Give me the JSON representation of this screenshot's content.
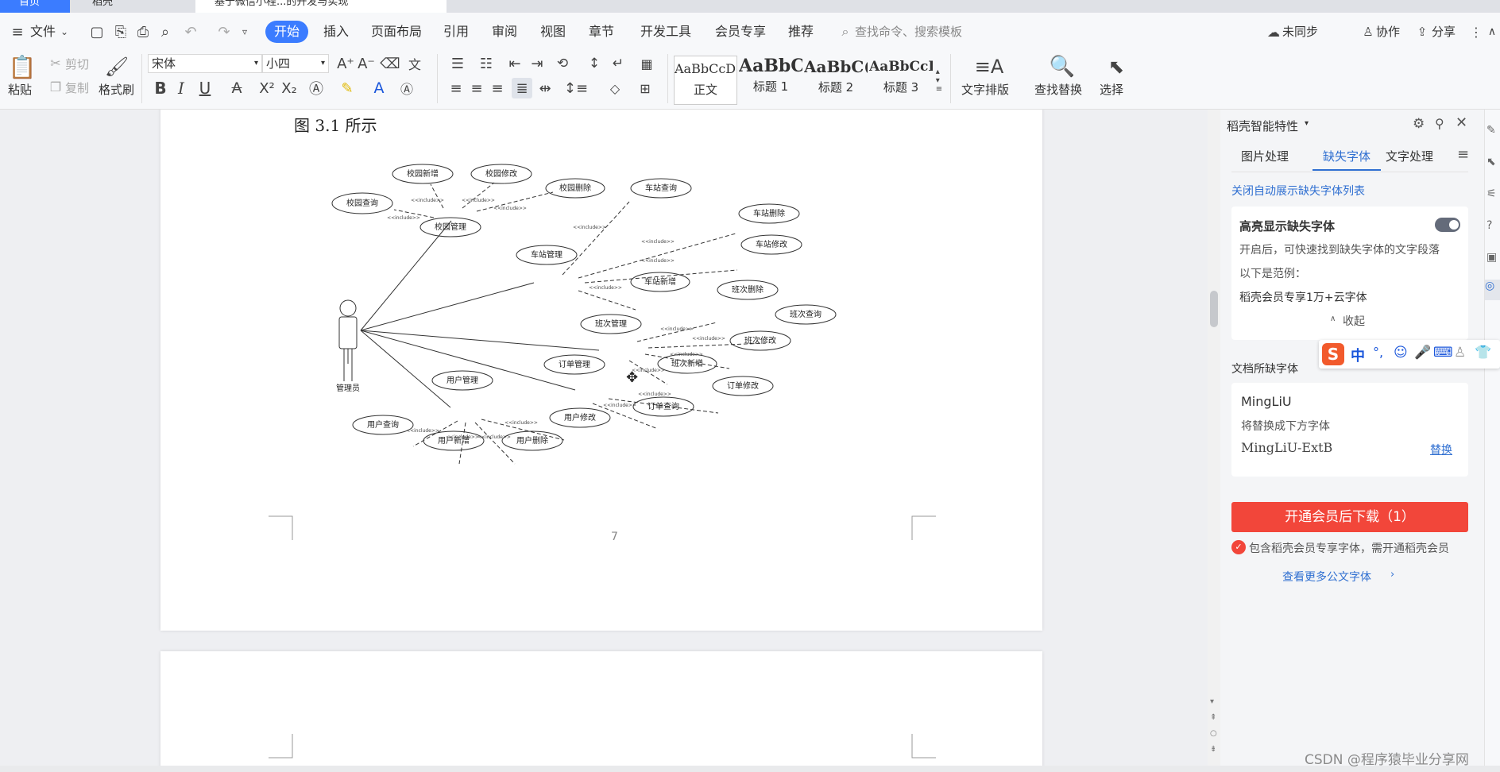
{
  "tabs": [
    {
      "label": "首页"
    },
    {
      "label": "稻壳"
    },
    {
      "label": "基于微信小程...的开发与实现"
    }
  ],
  "menu": {
    "file": "文件",
    "items": [
      "开始",
      "插入",
      "页面布局",
      "引用",
      "审阅",
      "视图",
      "章节",
      "开发工具",
      "会员专享",
      "推荐"
    ],
    "search_placeholder": "查找命令、搜索模板",
    "sync": "未同步",
    "collab": "协作",
    "share": "分享"
  },
  "ribbon": {
    "paste": "粘贴",
    "cut": "剪切",
    "copy": "复制",
    "format_painter": "格式刷",
    "font": "宋体",
    "size": "小四",
    "styles": [
      {
        "preview": "AaBbCcDd",
        "name": "正文"
      },
      {
        "preview": "AaBbC",
        "name": "标题 1"
      },
      {
        "preview": "AaBbC(",
        "name": "标题 2"
      },
      {
        "preview": "AaBbCcI",
        "name": "标题 3"
      }
    ],
    "text_layout": "文字排版",
    "find_replace": "查找替换",
    "select": "选择"
  },
  "document": {
    "caption": "图 3.1 所示",
    "page_number": "7"
  },
  "diagram": {
    "actor": "管理员",
    "include": "<<include>>",
    "nodes": {
      "campus_mgmt": "校园管理",
      "campus_add": "校园新增",
      "campus_edit": "校园修改",
      "campus_del": "校园删除",
      "campus_query": "校园查询",
      "station_mgmt": "车站管理",
      "station_query": "车站查询",
      "station_del": "车站删除",
      "station_edit": "车站修改",
      "station_add": "车站新增",
      "shift_mgmt": "班次管理",
      "shift_del": "班次删除",
      "shift_query": "班次查询",
      "shift_edit": "班次修改",
      "shift_add": "班次新增",
      "order_mgmt": "订单管理",
      "order_edit": "订单修改",
      "order_query": "订单查询",
      "user_mgmt": "用户管理",
      "user_query": "用户查询",
      "user_add": "用户新增",
      "user_del": "用户删除",
      "user_edit": "用户修改"
    }
  },
  "panel": {
    "title": "稻壳智能特性",
    "tabs": [
      "图片处理",
      "缺失字体",
      "文字处理"
    ],
    "auto_link": "关闭自动展示缺失字体列表",
    "highlight_title": "高亮显示缺失字体",
    "highlight_desc": "开启后，可快速找到缺失字体的文字段落",
    "example_label": "以下是范例：",
    "example_text": "稻壳会员专享1万+云字体",
    "collapse": "收起",
    "doc_missing": "文档所缺字体",
    "missing_font": "MingLiU",
    "replace_with": "将替换成下方字体",
    "replacement": "MingLiU-ExtB",
    "replace_btn": "替换",
    "download_btn": "开通会员后下载（1）",
    "member_note": "包含稻壳会员专享字体，需开通稻壳会员",
    "more_link": "查看更多公文字体"
  },
  "ime": {
    "lang": "中"
  },
  "watermark": "CSDN @程序猿毕业分享网",
  "colors": {
    "accent": "#3b7cff",
    "danger": "#f2463a",
    "link": "#2f6fd1"
  }
}
